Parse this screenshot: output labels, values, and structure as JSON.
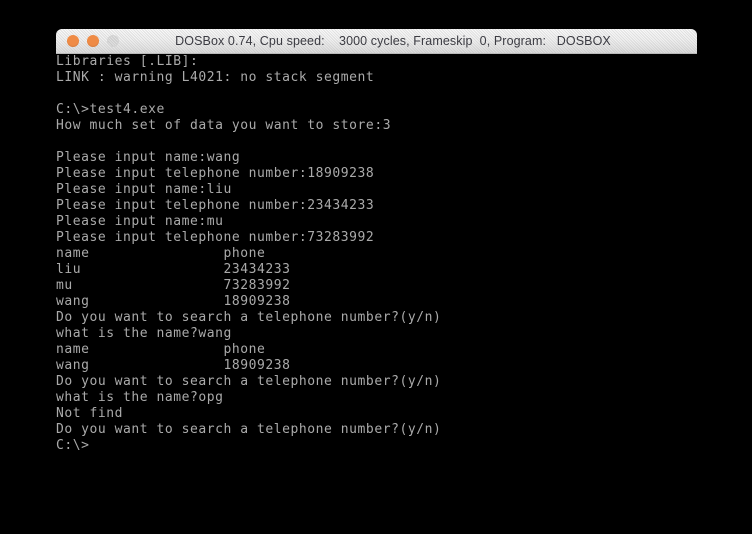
{
  "window": {
    "title": "DOSBox 0.74, Cpu speed:    3000 cycles, Frameskip  0, Program:   DOSBOX",
    "app_name": "DOSBox",
    "version": "0.74",
    "cpu_speed": "3000 cycles",
    "frameskip": "0",
    "program": "DOSBOX",
    "buttons": [
      {
        "name": "close-button",
        "style": "orange"
      },
      {
        "name": "minimize-button",
        "style": "orange"
      },
      {
        "name": "zoom-button",
        "style": "disabled"
      }
    ]
  },
  "colors": {
    "terminal_background": "#000000",
    "terminal_text": "#aaaaaa",
    "titlebar_text": "#3b3b42",
    "button_orange": "#ef8b46",
    "page_background": "#000000"
  },
  "terminal": {
    "lines": [
      "Libraries [.LIB]:",
      "LINK : warning L4021: no stack segment",
      "",
      "C:\\>test4.exe",
      "How much set of data you want to store:3",
      "",
      "Please input name:wang",
      "Please input telephone number:18909238",
      "Please input name:liu",
      "Please input telephone number:23434233",
      "Please input name:mu",
      "Please input telephone number:73283992",
      "name                phone",
      "liu                 23434233",
      "mu                  73283992",
      "wang                18909238",
      "Do you want to search a telephone number?(y/n)",
      "what is the name?wang",
      "name                phone",
      "wang                18909238",
      "Do you want to search a telephone number?(y/n)",
      "what is the name?opg",
      "Not find",
      "Do you want to search a telephone number?(y/n)",
      "C:\\>"
    ]
  }
}
